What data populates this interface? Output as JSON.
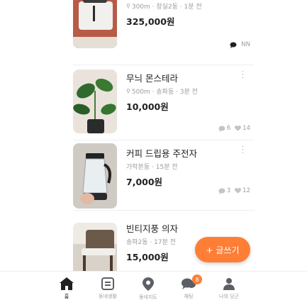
{
  "items": [
    {
      "title": "",
      "meta": "300m · 창실2동 · 1분 전",
      "price": "325,000원",
      "show_more": false,
      "stats": [
        {
          "icon": "chat-icon",
          "count": ""
        },
        {
          "icon": "heart-icon",
          "count": "NN"
        }
      ]
    },
    {
      "title": "무늬 몬스테라",
      "meta": "500m · 송파동 · 3분 전",
      "price": "10,000원",
      "show_more": true,
      "stats": [
        {
          "icon": "chat-icon",
          "count": "6"
        },
        {
          "icon": "heart-icon",
          "count": "14"
        }
      ]
    },
    {
      "title": "커피 드립용 주전자",
      "meta": "가락본동 · 15분 전",
      "price": "7,000원",
      "show_more": true,
      "stats": [
        {
          "icon": "chat-icon",
          "count": "3"
        },
        {
          "icon": "heart-icon",
          "count": "12"
        }
      ]
    },
    {
      "title": "빈티지풍 의자",
      "meta": "송파2동 · 17분 전",
      "price": "15,000원",
      "show_more": true,
      "stats": []
    }
  ],
  "fab": {
    "icon": "plus-icon",
    "label": "+ 글쓰기"
  },
  "tabbar": {
    "tabs": [
      {
        "key": "home",
        "label": "홈",
        "icon": "home-icon",
        "active": true
      },
      {
        "key": "community",
        "label": "동네생활",
        "icon": "community-icon",
        "active": false
      },
      {
        "key": "nearby",
        "label": "동네지도",
        "icon": "location-pin-icon",
        "active": false
      },
      {
        "key": "chat",
        "label": "채팅",
        "icon": "chat-bubbles-icon",
        "active": false,
        "badge": "8"
      },
      {
        "key": "my",
        "label": "나의 당근",
        "icon": "person-icon",
        "active": false
      }
    ]
  },
  "colors": {
    "accent": "#ff7e36",
    "text": "#212124",
    "muted": "#9a9ca1"
  }
}
